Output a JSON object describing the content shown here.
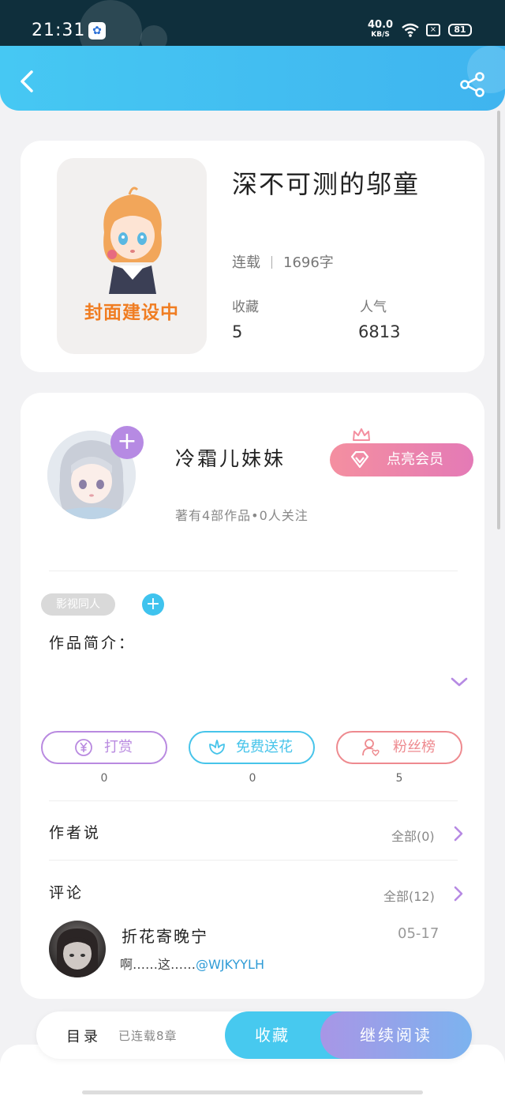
{
  "status_bar": {
    "time": "21:31",
    "net_speed": "40.0",
    "net_unit": "KB/S",
    "battery": "81"
  },
  "header": {
    "back_icon": "back-arrow-icon",
    "share_icon": "share-icon"
  },
  "book": {
    "cover_text": "封面建设中",
    "title": "深不可测的邬童",
    "status": "连载",
    "word_count": "1696字",
    "favorites_label": "收藏",
    "favorites_value": "5",
    "popularity_label": "人气",
    "popularity_value": "6813"
  },
  "author": {
    "name": "冷霜儿妹妹",
    "info": "著有4部作品•0人关注",
    "follow_symbol": "+",
    "vip_label": "点亮会员"
  },
  "tags": {
    "tag": "影视同人",
    "add_symbol": "+"
  },
  "intro": {
    "label": "作品简介："
  },
  "actions": [
    {
      "label": "打赏",
      "count": "0",
      "icon": "yen-coin-icon",
      "color": "#b98ae0"
    },
    {
      "label": "免费送花",
      "count": "0",
      "icon": "flower-icon",
      "color": "#47c4ea"
    },
    {
      "label": "粉丝榜",
      "count": "5",
      "icon": "fan-user-icon",
      "color": "#ee8a8f"
    }
  ],
  "author_says": {
    "title": "作者说",
    "all": "全部(0)"
  },
  "comments": {
    "title": "评论",
    "all": "全部(12)",
    "items": [
      {
        "user": "折花寄晚宁",
        "date": "05-17",
        "text": "啊……这……",
        "mention": "@WJKYYLH"
      }
    ]
  },
  "bottom_bar": {
    "toc_label": "目录",
    "toc_status": "已连载8章",
    "favorite_label": "收藏",
    "continue_label": "继续阅读"
  },
  "colors": {
    "accent_blue": "#46c8f3",
    "vip_pink": "#f48fa0",
    "cover_orange": "#f07d22"
  }
}
